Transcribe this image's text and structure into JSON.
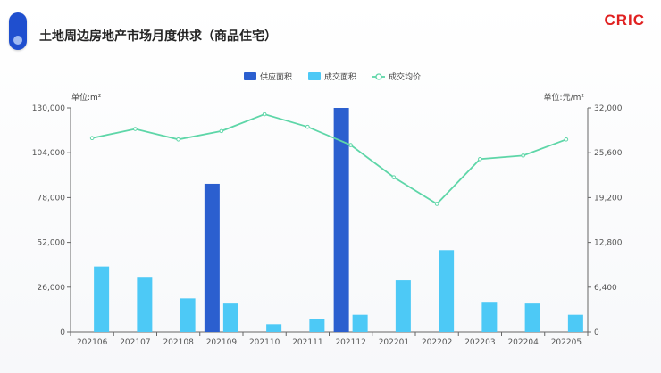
{
  "header": {
    "title": "土地周边房地产市场月度供求（商品住宅）",
    "logo": "CRIC"
  },
  "chart_data": {
    "type": "bar",
    "categories": [
      "202106",
      "202107",
      "202108",
      "202109",
      "202110",
      "202111",
      "202112",
      "202201",
      "202202",
      "202203",
      "202204",
      "202205"
    ],
    "series": [
      {
        "name": "供应面积",
        "kind": "bar",
        "axis": "left",
        "color": "#2b5fcf",
        "values": [
          0,
          0,
          0,
          86000,
          0,
          0,
          130000,
          0,
          0,
          0,
          0,
          0
        ]
      },
      {
        "name": "成交面积",
        "kind": "bar",
        "axis": "left",
        "color": "#4dc9f6",
        "values": [
          38000,
          32000,
          19500,
          16500,
          4500,
          7500,
          10000,
          30000,
          47500,
          17500,
          16500,
          10000
        ]
      },
      {
        "name": "成交均价",
        "kind": "line",
        "axis": "right",
        "color": "#5ed6a8",
        "values": [
          27700,
          29000,
          27500,
          28700,
          31100,
          29300,
          26700,
          22100,
          18300,
          24700,
          25200,
          27500
        ]
      }
    ],
    "left_axis": {
      "label": "单位:m²",
      "min": 0,
      "max": 130000,
      "ticks": [
        "0",
        "26,000",
        "52,000",
        "78,000",
        "104,000",
        "130,000"
      ]
    },
    "right_axis": {
      "label": "单位:元/m²",
      "min": 0,
      "max": 32000,
      "ticks": [
        "0",
        "6,400",
        "12,800",
        "19,200",
        "25,600",
        "32,000"
      ]
    },
    "legend_position": "top-center",
    "grid": false
  }
}
